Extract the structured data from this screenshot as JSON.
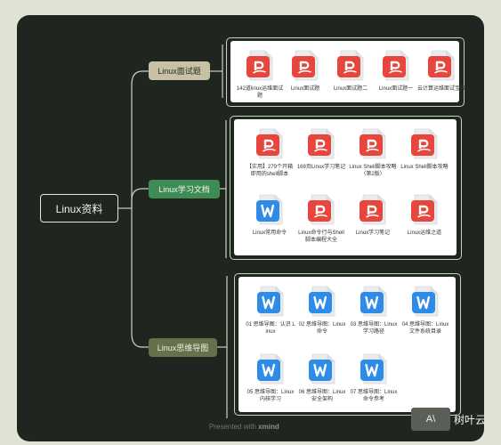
{
  "root": {
    "label": "Linux资料"
  },
  "topics": [
    {
      "label": "Linux面试题",
      "files": [
        {
          "type": "pdf",
          "name": "142道linux运维面试题"
        },
        {
          "type": "pdf",
          "name": "Linux面试题"
        },
        {
          "type": "pdf",
          "name": "Linux面试题二"
        },
        {
          "type": "pdf",
          "name": "Linux面试题一"
        },
        {
          "type": "pdf",
          "name": "云计算运维面试宝典"
        }
      ]
    },
    {
      "label": "Linux学习文档",
      "files": [
        {
          "type": "pdf",
          "name": "【实用】279个开箱即用的shell脚本"
        },
        {
          "type": "pdf",
          "name": "168页Linux学习笔记"
        },
        {
          "type": "pdf",
          "name": "Linux Shell脚本攻略（第2版）"
        },
        {
          "type": "pdf",
          "name": "Linux Shell脚本攻略"
        },
        {
          "type": "word",
          "name": "Linux常用命令"
        },
        {
          "type": "pdf",
          "name": "Linux命令行与Shell脚本编程大全"
        },
        {
          "type": "pdf",
          "name": "Linux学习笔记"
        },
        {
          "type": "pdf",
          "name": "Linux运维之道"
        }
      ]
    },
    {
      "label": "Linux思维导图",
      "files": [
        {
          "type": "word",
          "name": "01 思维导图：认识 Linux"
        },
        {
          "type": "word",
          "name": "02 思维导图：Linux 命令"
        },
        {
          "type": "word",
          "name": "03 思维导图：Linux 学习路径"
        },
        {
          "type": "word",
          "name": "04 思维导图：Linux 文件系统目录"
        },
        {
          "type": "word",
          "name": "05 思维导图：Linux 内核学习"
        },
        {
          "type": "word",
          "name": "06 思维导图：Linux 安全架构"
        },
        {
          "type": "word",
          "name": "07 思维导图：Linux 命令参考"
        }
      ]
    }
  ],
  "footer": {
    "prefix": "Presented with",
    "brand": "xmind"
  },
  "watermark": {
    "logo": "A\\",
    "text": "树叶云"
  },
  "colors": {
    "canvas": "#1f2620",
    "pdf": "#e8453c",
    "word": "#2e8be6"
  }
}
